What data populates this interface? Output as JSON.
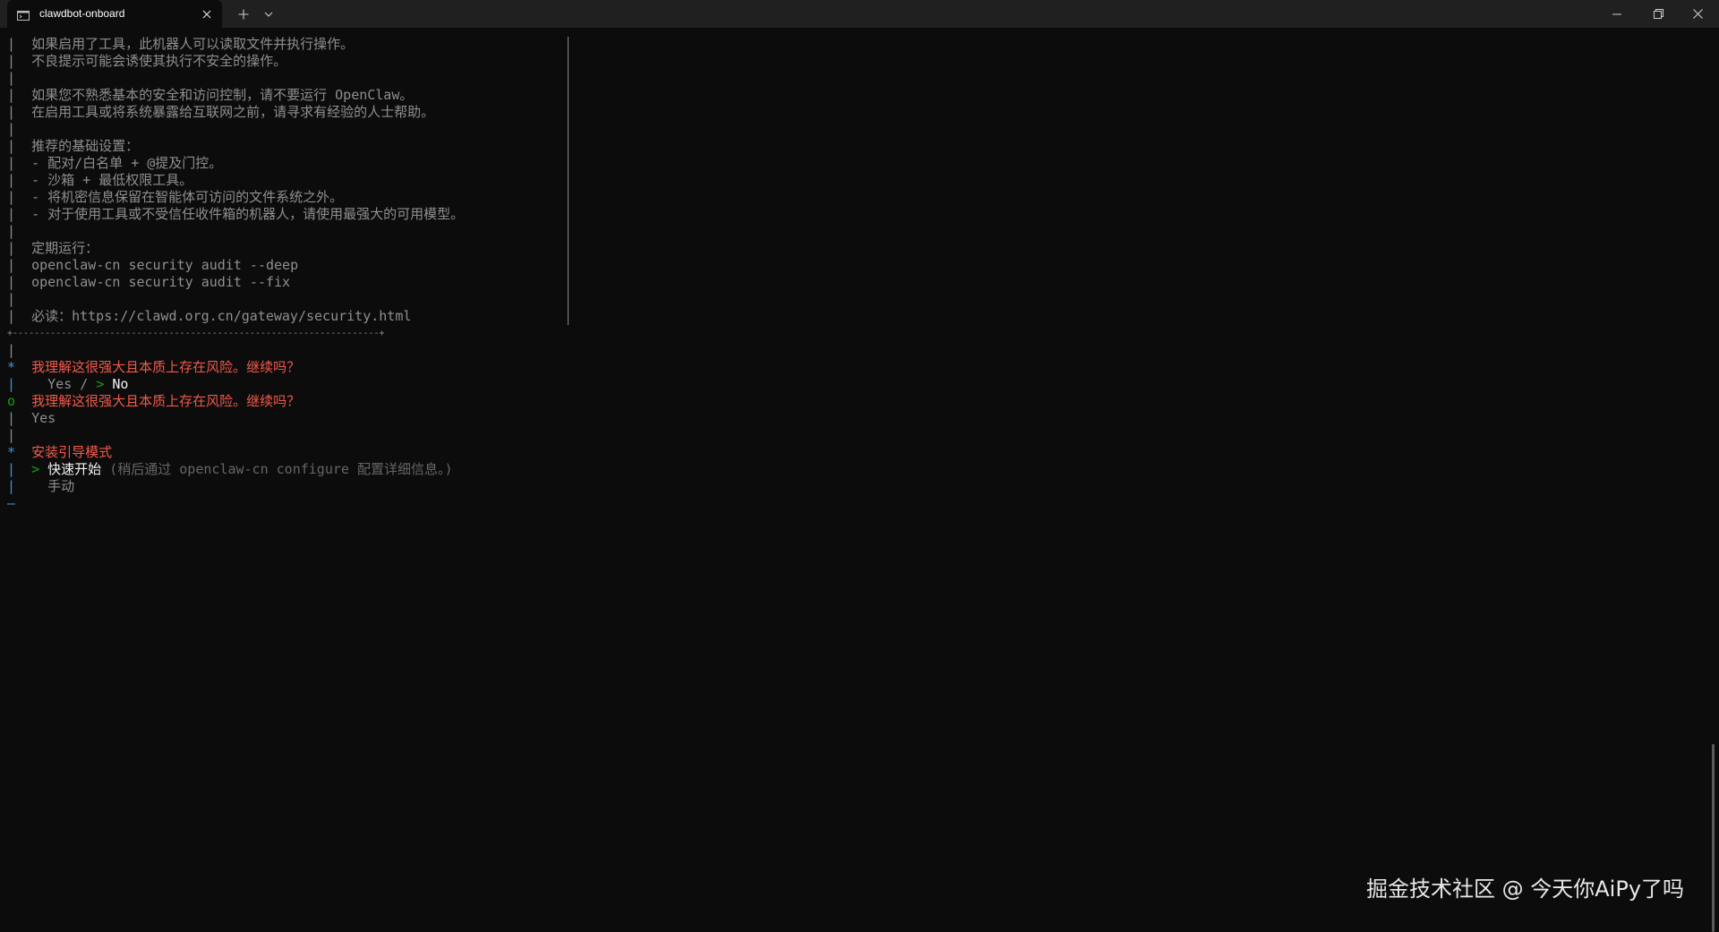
{
  "window": {
    "tab_title": "clawdbot-onboard",
    "tab_icon": "terminal-icon",
    "new_tab_icon": "plus-icon",
    "dropdown_icon": "chevron-down-icon",
    "minimize_icon": "minimize-icon",
    "maximize_icon": "restore-icon",
    "close_icon": "close-icon"
  },
  "notice": {
    "lines": [
      "如果启用了工具，此机器人可以读取文件并执行操作。",
      "不良提示可能会诱使其执行不安全的操作。",
      "",
      "如果您不熟悉基本的安全和访问控制，请不要运行 OpenClaw。",
      "在启用工具或将系统暴露给互联网之前，请寻求有经验的人士帮助。",
      "",
      "推荐的基础设置：",
      "- 配对/白名单 + @提及门控。",
      "- 沙箱 + 最低权限工具。",
      "- 将机密信息保留在智能体可访问的文件系统之外。",
      "- 对于使用工具或不受信任收件箱的机器人，请使用最强大的可用模型。",
      "",
      "定期运行：",
      "openclaw-cn security audit --deep",
      "openclaw-cn security audit --fix",
      "",
      "必读：https://clawd.org.cn/gateway/security.html"
    ],
    "bottom_border": "+--------------------------------------------------------------------+"
  },
  "prompt_risk_active": {
    "marker": "*",
    "question": "我理解这很强大且本质上存在风险。继续吗？",
    "option_yes": "Yes",
    "separator": " / ",
    "cursor": ">",
    "option_no": "No"
  },
  "prompt_risk_done": {
    "marker": "o",
    "question": "我理解这很强大且本质上存在风险。继续吗？",
    "answer": "Yes"
  },
  "prompt_mode": {
    "marker": "*",
    "question": "安装引导模式",
    "cursor": ">",
    "option_quick": "快速开始",
    "option_quick_hint": "(稍后通过 openclaw-cn configure 配置详细信息。)",
    "option_manual": "手动",
    "end_marker": "—"
  },
  "gutter": "|",
  "watermark": "掘金技术社区 @ 今天你AiPy了吗"
}
